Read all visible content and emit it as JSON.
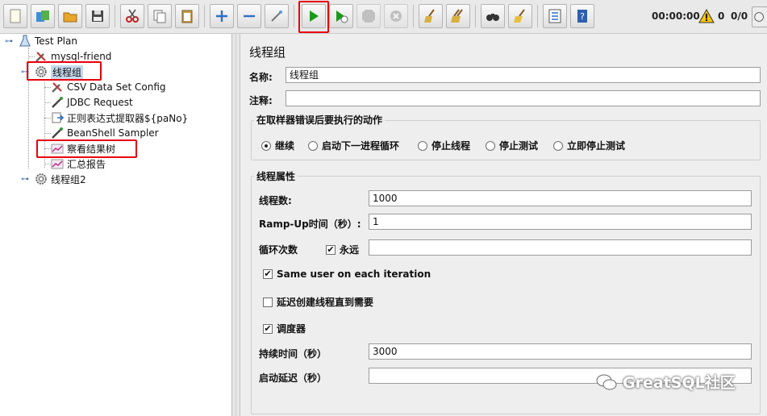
{
  "toolbar": {
    "buttons": [
      {
        "name": "new-button",
        "icon": "new-document-icon"
      },
      {
        "name": "templates-button",
        "icon": "templates-icon"
      },
      {
        "name": "open-button",
        "icon": "open-folder-icon"
      },
      {
        "name": "save-button",
        "icon": "save-disk-icon"
      },
      {
        "name": "cut-button",
        "icon": "scissors-icon"
      },
      {
        "name": "copy-button",
        "icon": "copy-icon"
      },
      {
        "name": "paste-button",
        "icon": "paste-clipboard-icon"
      },
      {
        "name": "expand-button",
        "icon": "plus-icon"
      },
      {
        "name": "collapse-button",
        "icon": "minus-icon"
      },
      {
        "name": "toggle-button",
        "icon": "toggle-wand-icon"
      },
      {
        "name": "start-button",
        "icon": "play-icon"
      },
      {
        "name": "start-no-pauses-button",
        "icon": "play-no-timer-icon"
      },
      {
        "name": "stop-button",
        "icon": "stop-icon"
      },
      {
        "name": "shutdown-button",
        "icon": "shutdown-icon"
      },
      {
        "name": "clear-button",
        "icon": "broom-clear-icon"
      },
      {
        "name": "clear-all-button",
        "icon": "broom-clear-all-icon"
      },
      {
        "name": "search-button",
        "icon": "binoculars-icon"
      },
      {
        "name": "reset-search-button",
        "icon": "broom-icon"
      },
      {
        "name": "function-helper-button",
        "icon": "list-icon"
      },
      {
        "name": "help-button",
        "icon": "help-book-icon"
      }
    ],
    "elapsed_time": "00:00:00",
    "warning_count": "0",
    "threads_ratio": "0/0",
    "colors": {
      "play": "#1a9a1a",
      "highlight": "#e8000b",
      "warning": "#f5c400"
    }
  },
  "tree": {
    "nodes": [
      {
        "label": "Test Plan",
        "icon": "test-plan-flask-icon"
      },
      {
        "label": "mysql-friend",
        "icon": "config-wrench-icon"
      },
      {
        "label": "线程组",
        "icon": "thread-group-gear-icon"
      },
      {
        "label": "CSV Data Set Config",
        "icon": "config-wrench-icon"
      },
      {
        "label": "JDBC Request",
        "icon": "sampler-pipette-icon"
      },
      {
        "label": "正则表达式提取器${paNo}",
        "icon": "extractor-icon"
      },
      {
        "label": "BeanShell Sampler",
        "icon": "sampler-pipette-icon"
      },
      {
        "label": "察看结果树",
        "icon": "listener-graph-icon"
      },
      {
        "label": "汇总报告",
        "icon": "listener-graph-icon"
      },
      {
        "label": "线程组2",
        "icon": "thread-group-gear-icon"
      }
    ]
  },
  "panel": {
    "title": "线程组",
    "name_label": "名称:",
    "name_value": "线程组",
    "comment_label": "注释:",
    "comment_value": "",
    "error_group_title": "在取样器错误后要执行的动作",
    "error_actions": [
      "继续",
      "启动下一进程循环",
      "停止线程",
      "停止测试",
      "立即停止测试"
    ],
    "error_selected": "继续",
    "props_title": "线程属性",
    "threads_label": "线程数:",
    "threads_value": "1000",
    "rampup_label": "Ramp-Up时间（秒）:",
    "rampup_value": "1",
    "loop_label": "循环次数",
    "forever_label": "永远",
    "forever_checked": true,
    "loop_value": "",
    "same_user_label": "Same user on each iteration",
    "same_user_checked": true,
    "delay_label": "延迟创建线程直到需要",
    "delay_checked": false,
    "scheduler_label": "调度器",
    "scheduler_checked": true,
    "duration_label": "持续时间（秒）",
    "duration_value": "3000",
    "startup_delay_label": "启动延迟（秒）",
    "startup_delay_value": ""
  },
  "watermark": {
    "text": "GreatSQL社区",
    "icon": "wechat-icon"
  }
}
